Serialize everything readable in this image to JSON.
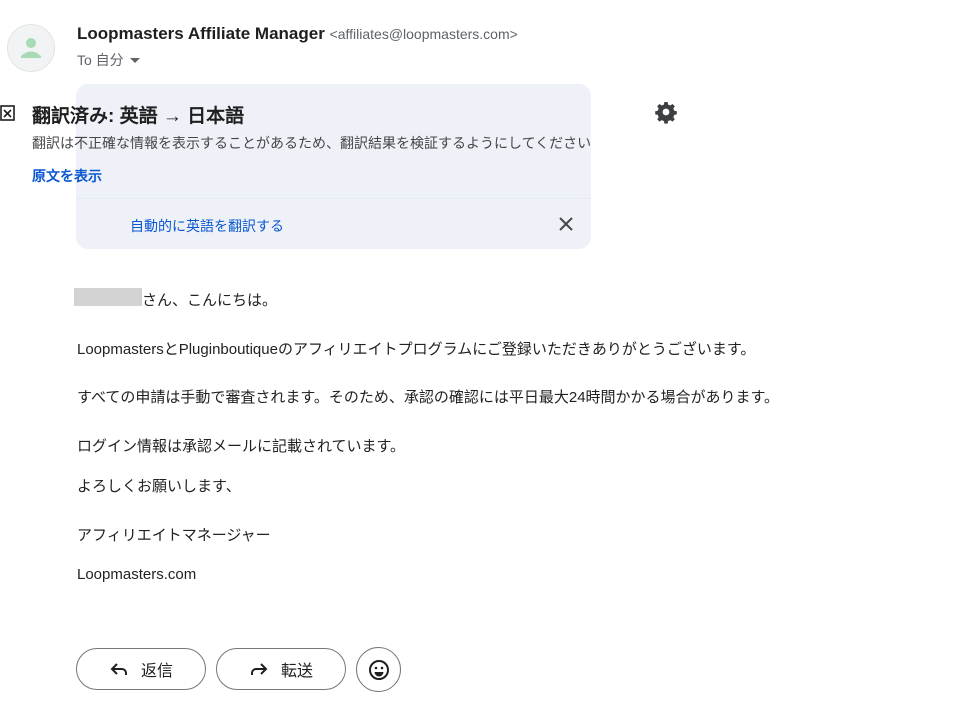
{
  "sender": {
    "name": "Loopmasters Affiliate Manager",
    "email": "<affiliates@loopmasters.com>",
    "to_label": "To 自分"
  },
  "translation": {
    "title": "翻訳済み: 英語 → 日本語",
    "notice": "翻訳は不正確な情報を表示することがあるため、翻訳結果を検証するようにしてください",
    "show_original": "原文を表示",
    "auto_translate": "自動的に英語を翻訳する"
  },
  "body": {
    "greeting": "さん、こんにちは。",
    "p1": "LoopmastersとPluginboutiqueのアフィリエイトプログラムにご登録いただきありがとうございます。",
    "p2": "すべての申請は手動で審査されます。そのため、承認の確認には平日最大24時間かかる場合があります。",
    "p3": "ログイン情報は承認メールに記載されています。",
    "p4": "よろしくお願いします、",
    "sign1": "アフィリエイトマネージャー",
    "sign2": "Loopmasters.com"
  },
  "actions": {
    "reply": "返信",
    "forward": "転送"
  },
  "colors": {
    "link": "#0b57d0",
    "panel_bg": "#eef2f8",
    "avatar_icon": "#a8dab5"
  },
  "icons": [
    "person-icon",
    "dropdown-arrow-icon",
    "translate-icon",
    "gear-icon",
    "close-icon",
    "reply-icon",
    "forward-icon",
    "emoji-icon"
  ]
}
